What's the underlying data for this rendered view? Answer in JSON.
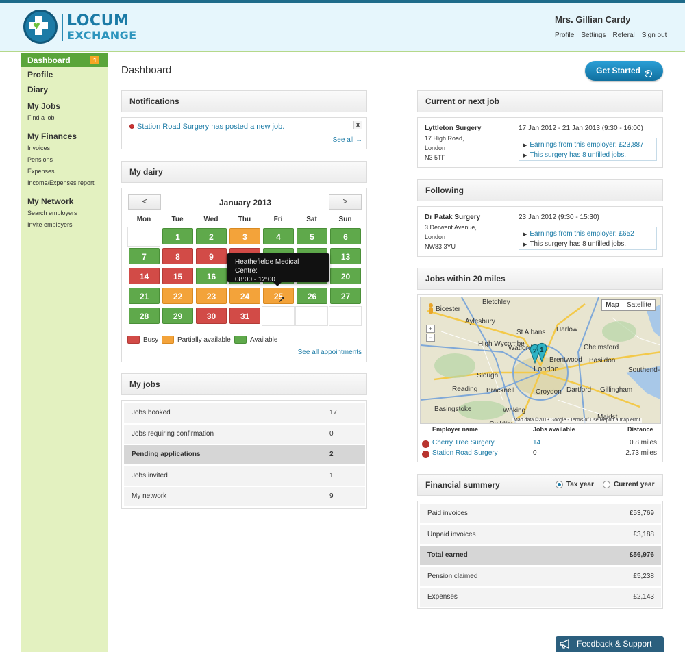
{
  "header": {
    "logo_line1": "LOCUM",
    "logo_line2": "EXCHANGE",
    "user_name": "Mrs. Gillian Cardy",
    "links": [
      "Profile",
      "Settings",
      "Referal",
      "Sign out"
    ]
  },
  "sidebar": {
    "active": {
      "label": "Dashboard",
      "badge": "1"
    },
    "items": [
      "Profile",
      "Diary"
    ],
    "groups": [
      {
        "label": "My Jobs",
        "subs": [
          "Find a job"
        ]
      },
      {
        "label": "My Finances",
        "subs": [
          "Invoices",
          "Pensions",
          "Expenses",
          "Income/Expenses report"
        ]
      },
      {
        "label": "My Network",
        "subs": [
          "Search employers",
          "Invite employers"
        ]
      }
    ]
  },
  "page": {
    "title": "Dashboard",
    "get_started": "Get Started"
  },
  "notifications": {
    "title": "Notifications",
    "message": "Station Road Surgery has posted a new job.",
    "close": "x",
    "see_all": "See all →"
  },
  "diary": {
    "title": "My dairy",
    "prev": "<",
    "next": ">",
    "month": "January 2013",
    "weekdays": [
      "Mon",
      "Tue",
      "Wed",
      "Thu",
      "Fri",
      "Sat",
      "Sun"
    ],
    "days": [
      {
        "d": "1",
        "s": "green"
      },
      {
        "d": "2",
        "s": "green"
      },
      {
        "d": "3",
        "s": "orange"
      },
      {
        "d": "4",
        "s": "green"
      },
      {
        "d": "5",
        "s": "green"
      },
      {
        "d": "6",
        "s": "green"
      },
      {
        "d": "7",
        "s": "green"
      },
      {
        "d": "8",
        "s": "red"
      },
      {
        "d": "9",
        "s": "red"
      },
      {
        "d": "10",
        "s": "red"
      },
      {
        "d": "11",
        "s": "green"
      },
      {
        "d": "12",
        "s": "green"
      },
      {
        "d": "13",
        "s": "green"
      },
      {
        "d": "14",
        "s": "red"
      },
      {
        "d": "15",
        "s": "red"
      },
      {
        "d": "16",
        "s": "green"
      },
      {
        "d": "17",
        "s": "green"
      },
      {
        "d": "18",
        "s": "green"
      },
      {
        "d": "19",
        "s": "green"
      },
      {
        "d": "20",
        "s": "green"
      },
      {
        "d": "21",
        "s": "green"
      },
      {
        "d": "22",
        "s": "orange"
      },
      {
        "d": "23",
        "s": "orange"
      },
      {
        "d": "24",
        "s": "orange"
      },
      {
        "d": "25",
        "s": "orange"
      },
      {
        "d": "26",
        "s": "green"
      },
      {
        "d": "27",
        "s": "green"
      },
      {
        "d": "28",
        "s": "green"
      },
      {
        "d": "29",
        "s": "green"
      },
      {
        "d": "30",
        "s": "red"
      },
      {
        "d": "31",
        "s": "red"
      }
    ],
    "tooltip_line1": "Heathefielde Medical Centre:",
    "tooltip_line2": "08:00 - 12:00",
    "legend": {
      "busy": "Busy",
      "partial": "Partially available",
      "available": "Available"
    },
    "see_all": "See all appointments"
  },
  "my_jobs": {
    "title": "My jobs",
    "rows": [
      {
        "label": "Jobs booked",
        "value": "17"
      },
      {
        "label": "Jobs requiring confirmation",
        "value": "0"
      },
      {
        "label": "Pending applications",
        "value": "2"
      },
      {
        "label": "Jobs invited",
        "value": "1"
      },
      {
        "label": "My network",
        "value": "9"
      }
    ]
  },
  "current_job": {
    "title": "Current or next job",
    "name": "Lyttleton Surgery",
    "addr": [
      "17 High Road,",
      "London",
      "N3 5TF"
    ],
    "dates": "17 Jan 2012 - 21 Jan 2013 (9:30 - 16:00)",
    "earnings": "Earnings from this employer: £23,887",
    "unfilled": "This surgery has 8 unfilled jobs."
  },
  "following": {
    "title": "Following",
    "name": "Dr Patak Surgery",
    "addr": [
      "3 Derwent Avenue,",
      "London",
      "NW83 3YU"
    ],
    "dates": "23 Jan 2012 (9:30 - 15:30)",
    "earnings": "Earnings from this employer: £652",
    "unfilled": "This surgery has 8 unfilled jobs."
  },
  "nearby": {
    "title": "Jobs within 20 miles",
    "map_btn": "Map",
    "sat_btn": "Satellite",
    "credits": "Map data ©2013 Google - Terms of Use   Report a map error",
    "places": [
      "Bicester",
      "Bletchley",
      "Aylesbury",
      "St Albans",
      "Harlow",
      "Chelmsford",
      "High Wycombe",
      "Watford",
      "Brentwood",
      "Basildon",
      "Slough",
      "London",
      "Southend-",
      "Reading",
      "Bracknell",
      "Croydon",
      "Dartford",
      "Gillingham",
      "Basingstoke",
      "Woking",
      "Maidst",
      "Guildford"
    ],
    "markers": [
      "2",
      "1"
    ],
    "headers": [
      "Employer name",
      "Jobs available",
      "Distance"
    ],
    "employers": [
      {
        "name": "Cherry Tree Surgery",
        "jobs": "14",
        "distance": "0.8 miles"
      },
      {
        "name": "Station Road Surgery",
        "jobs": "0",
        "distance": "2.73 miles"
      }
    ]
  },
  "finance": {
    "title": "Financial summery",
    "opt_tax": "Tax year",
    "opt_current": "Current year",
    "rows": [
      {
        "label": "Paid invoices",
        "value": "£53,769"
      },
      {
        "label": "Unpaid invoices",
        "value": "£3,188"
      },
      {
        "label": "Total earned",
        "value": "£56,976"
      },
      {
        "label": "Pension claimed",
        "value": "£5,238"
      },
      {
        "label": "Expenses",
        "value": "£2,143"
      }
    ]
  },
  "feedback": "Feedback & Support",
  "colors": {
    "green": "#5fa94b",
    "red": "#d24b47",
    "orange": "#f3a33a",
    "brand": "#1c7ba6"
  }
}
